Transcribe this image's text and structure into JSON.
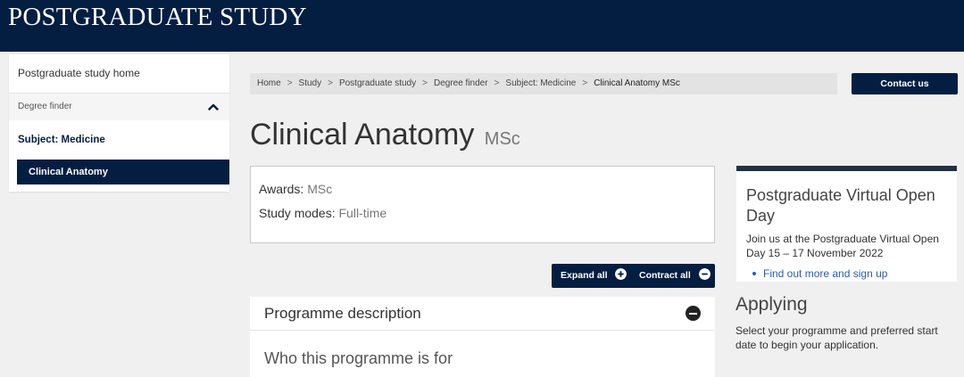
{
  "header": {
    "site_title": "POSTGRADUATE STUDY"
  },
  "sidebar": {
    "home_label": "Postgraduate study home",
    "finder_label": "Degree finder",
    "subject_label": "Subject: Medicine",
    "current_label": "Clinical Anatomy",
    "finder_expanded_icon": "chevron-up-icon"
  },
  "breadcrumb": {
    "items": [
      "Home",
      "Study",
      "Postgraduate study",
      "Degree finder",
      "Subject: Medicine"
    ],
    "current": "Clinical Anatomy MSc",
    "separator": ">"
  },
  "contact_button": "Contact us",
  "title": {
    "main": "Clinical Anatomy",
    "award": "MSc"
  },
  "summary": {
    "awards_label": "Awards:",
    "awards_value": "MSc",
    "modes_label": "Study modes:",
    "modes_value": "Full-time"
  },
  "accordion_controls": {
    "expand_label": "Expand all",
    "contract_label": "Contract all"
  },
  "programme": {
    "heading": "Programme description",
    "subheading": "Who this programme is for"
  },
  "open_day": {
    "title": "Postgraduate Virtual Open Day",
    "text": "Join us at the Postgraduate Virtual Open Day 15 – 17 November 2022",
    "link": "Find out more and sign up"
  },
  "applying": {
    "heading": "Applying",
    "text": "Select your programme and preferred start date to begin your application."
  },
  "colors": {
    "navy": "#041e42",
    "page_bg": "#f0f0f0",
    "link": "#2a5db0"
  }
}
